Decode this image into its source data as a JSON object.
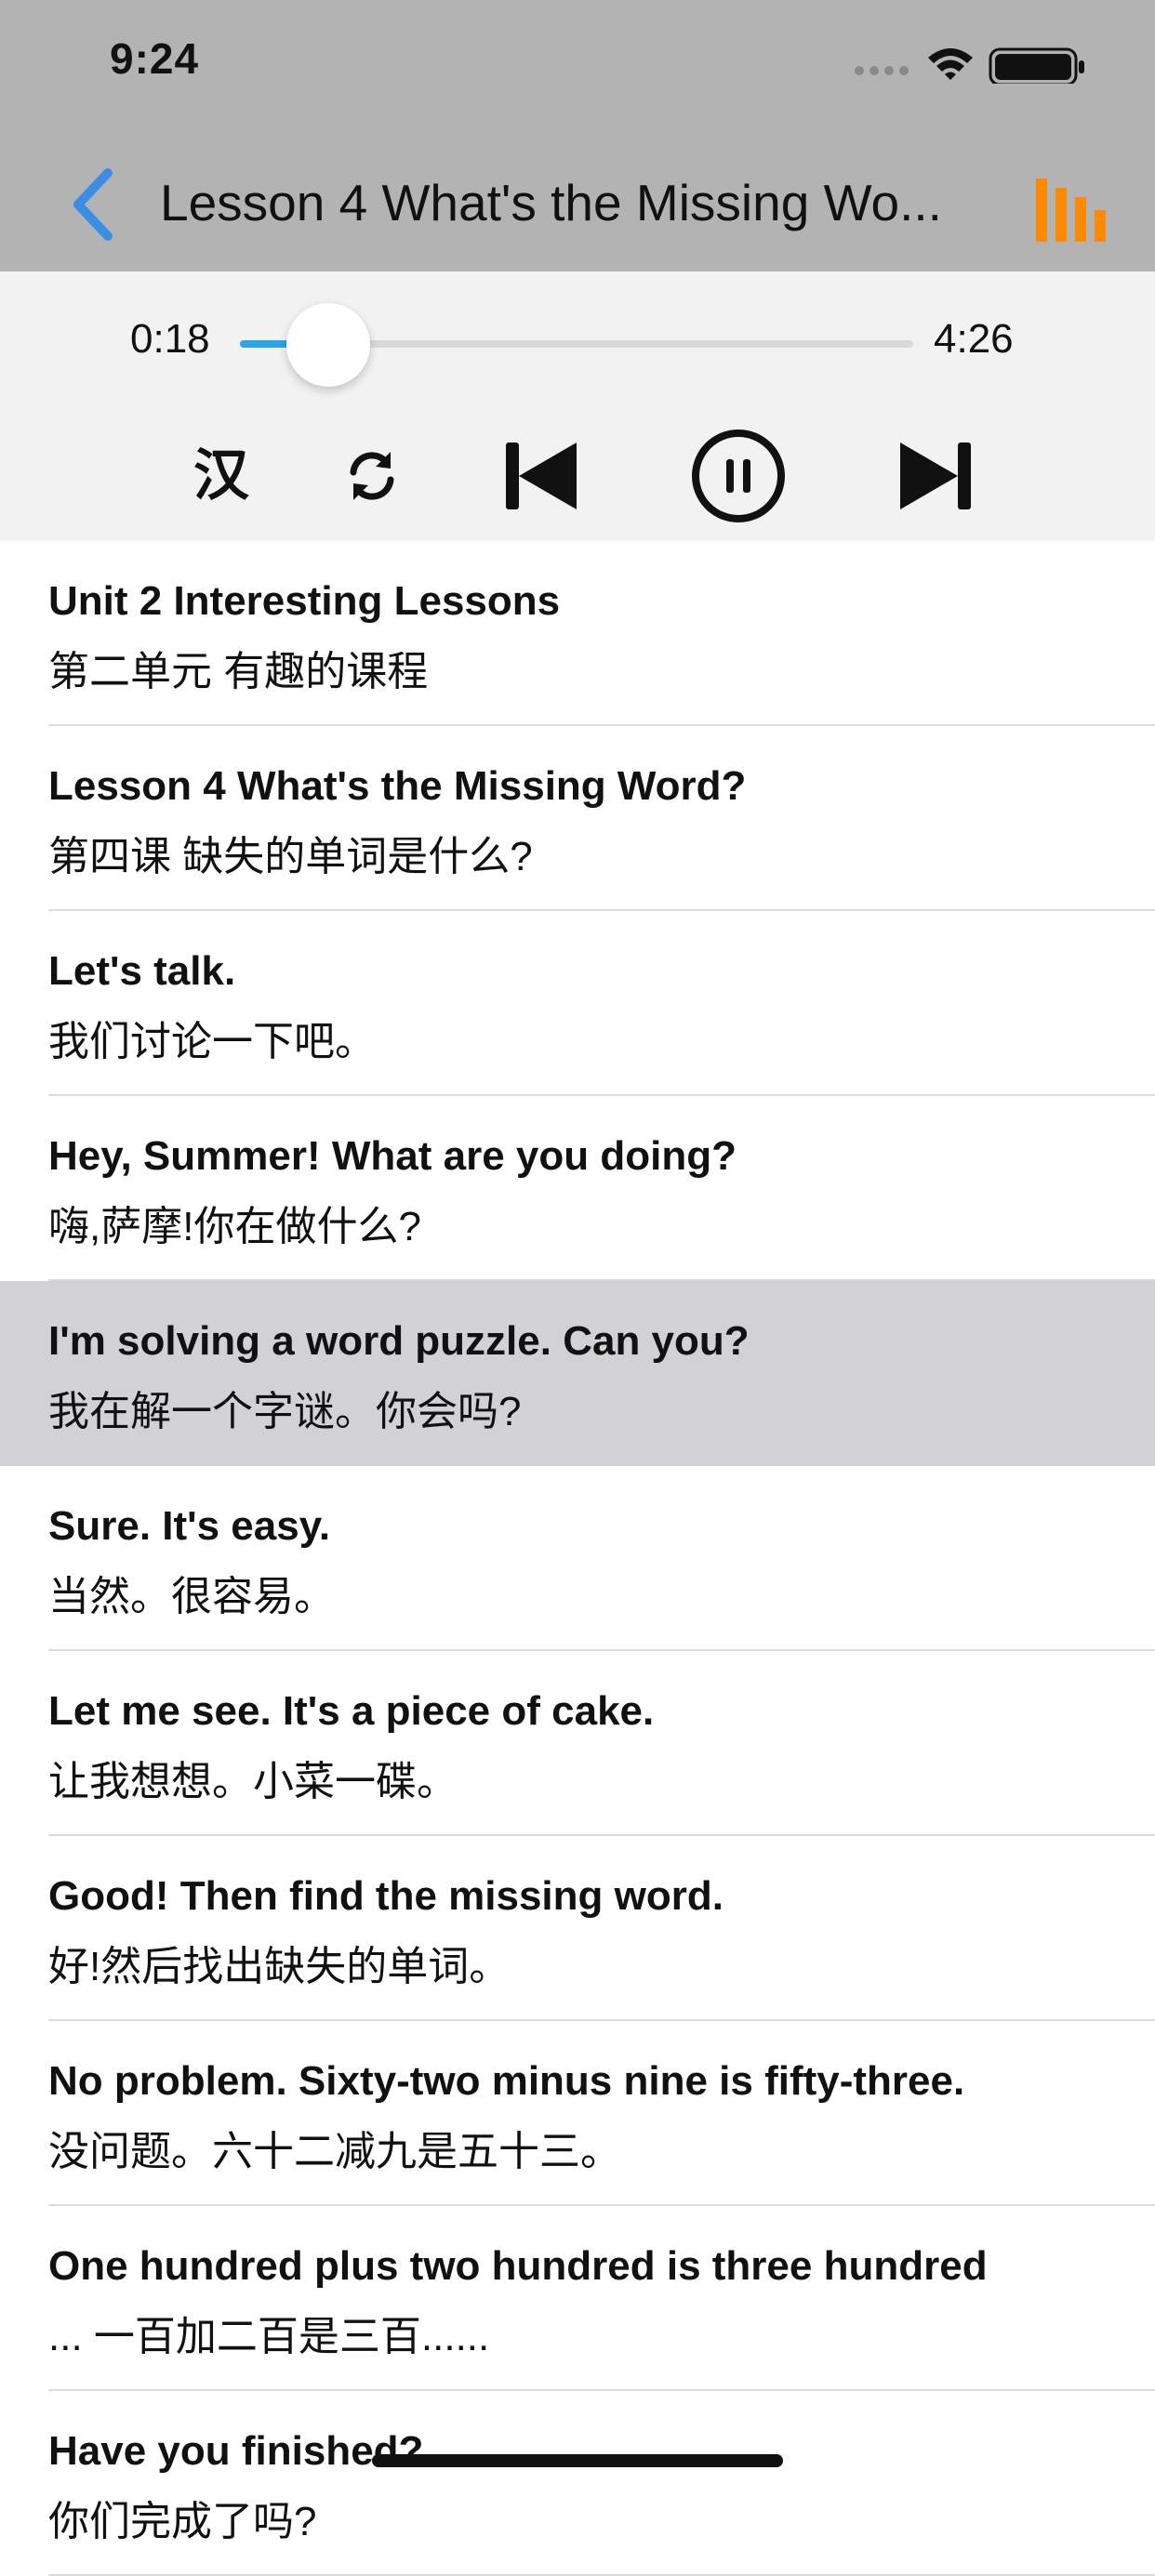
{
  "status_bar": {
    "time": "9:24",
    "icons": [
      "signal-dots-icon",
      "wifi-icon",
      "battery-icon"
    ]
  },
  "nav": {
    "back_icon": "chevron-left-icon",
    "title": "Lesson 4 What's the Missing Wo...",
    "menu_icon": "bars-chart-icon",
    "accent": "#3a8ee6",
    "menu_color": "#ff8a00"
  },
  "player": {
    "current_time": "0:18",
    "total_time": "4:26",
    "progress": 0.07,
    "translate_toggle_label": "汉",
    "controls": [
      "repeat-icon",
      "previous-icon",
      "pause-icon",
      "next-icon"
    ],
    "track_color": "#2aa6e8"
  },
  "lines": [
    {
      "en": "Unit 2 Interesting Lessons",
      "zh": "第二单元 有趣的课程",
      "selected": false
    },
    {
      "en": "Lesson 4 What's the Missing Word?",
      "zh": "第四课 缺失的单词是什么?",
      "selected": false
    },
    {
      "en": "Let's talk.",
      "zh": "我们讨论一下吧。",
      "selected": false
    },
    {
      "en": "Hey, Summer! What are you doing?",
      "zh": "嗨,萨摩!你在做什么?",
      "selected": false
    },
    {
      "en": "I'm solving a word puzzle. Can you?",
      "zh": "我在解一个字谜。你会吗?",
      "selected": true
    },
    {
      "en": "Sure. It's easy.",
      "zh": "当然。很容易。",
      "selected": false
    },
    {
      "en": "Let me see. It's a piece of cake.",
      "zh": "让我想想。小菜一碟。",
      "selected": false
    },
    {
      "en": "Good! Then find the missing word.",
      "zh": "好!然后找出缺失的单词。",
      "selected": false
    },
    {
      "en": "No problem. Sixty-two minus nine is fifty-three.",
      "zh": "没问题。六十二减九是五十三。",
      "selected": false
    },
    {
      "en": "One hundred plus two hundred is three hundred",
      "zh": "... 一百加二百是三百......",
      "selected": false
    },
    {
      "en": "Have you finished?",
      "zh": "你们完成了吗?",
      "selected": false
    }
  ]
}
